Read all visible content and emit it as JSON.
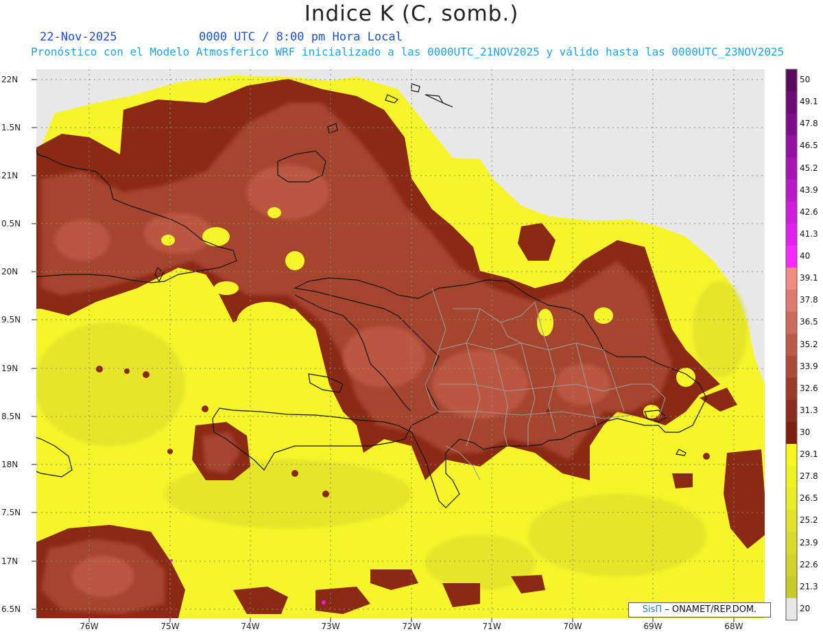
{
  "header": {
    "title": "Indice K (C, somb.)",
    "date": "22-Nov-2025",
    "time": "0000 UTC / 8:00 pm Hora Local",
    "subtitle": "Pronóstico con el Modelo Atmosferico WRF inicializado a las 0000UTC_21NOV2025 y válido hasta las  0000UTC_23NOV2025"
  },
  "map": {
    "lat_labels": [
      "22N",
      "1.5N",
      "21N",
      "0.5N",
      "20N",
      "9.5N",
      "19N",
      "8.5N",
      "18N",
      "7.5N",
      "17N",
      "6.5N"
    ],
    "lon_labels": [
      "76W",
      "75W",
      "74W",
      "73W",
      "72W",
      "71W",
      "70W",
      "69W",
      "68W"
    ],
    "colors": {
      "missing": "#e8e8e8",
      "yellow": "#f5f52a",
      "olive": "#d8d82a",
      "brown_dark": "#8a2a14",
      "brown_mid": "#a6452d",
      "brown_light": "#bf5a45",
      "coast": "#111111",
      "provinces": "#9a9a9a"
    }
  },
  "colorbar": {
    "labels": [
      "50",
      "49.1",
      "47.8",
      "46.5",
      "45.2",
      "43.9",
      "42.6",
      "41.3",
      "40",
      "39.1",
      "37.8",
      "36.5",
      "35.2",
      "33.9",
      "32.6",
      "31.3",
      "30",
      "29.1",
      "27.8",
      "26.5",
      "25.2",
      "23.9",
      "22.6",
      "21.3",
      "20"
    ],
    "colors": [
      "#5a0a5e",
      "#6e0a78",
      "#800a8c",
      "#9410a0",
      "#a814b4",
      "#bc18c8",
      "#d01cdc",
      "#e420f0",
      "#f828ff",
      "#f28a82",
      "#de7a70",
      "#cc6a5c",
      "#bc5a4a",
      "#ac4a3a",
      "#9c3a2a",
      "#8c2c1c",
      "#7c2010",
      "#f8f81c",
      "#f2f222",
      "#eaea26",
      "#e2e22a",
      "#dada2a",
      "#d2d228",
      "#caca26",
      "#e8e8e8"
    ]
  },
  "credit": {
    "brand": "SisΠ",
    "text": "– ONAMET/REP.DOM."
  }
}
